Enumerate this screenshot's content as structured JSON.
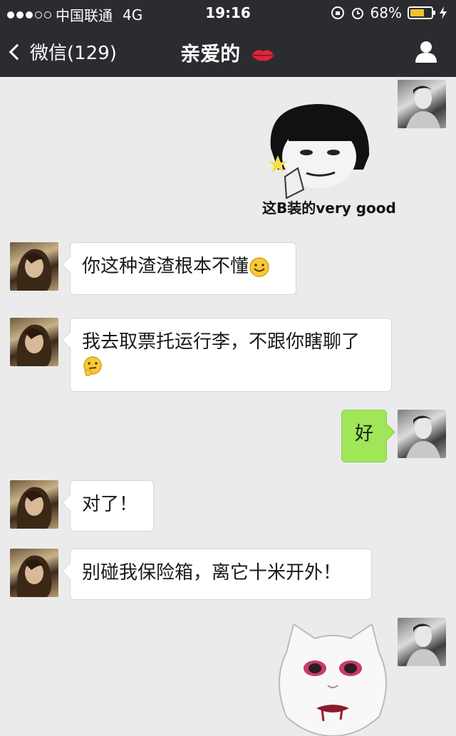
{
  "status_bar": {
    "carrier": "中国联通",
    "network": "4G",
    "time": "19:16",
    "battery_percent": "68%",
    "battery_level": 0.68,
    "battery_color": "#f2c12e"
  },
  "nav": {
    "back_label": "微信(129)",
    "title": "亲爱的",
    "title_icon": "lips-icon",
    "profile_icon": "person-icon"
  },
  "messages": [
    {
      "side": "right",
      "type": "sticker",
      "caption": "这B装的very good"
    },
    {
      "side": "left",
      "type": "text",
      "text": "你这种渣渣根本不懂",
      "emoji": "smile-icon"
    },
    {
      "side": "left",
      "type": "text",
      "line1": "我去取票托运行李，不跟你瞎聊了",
      "emoji": "thinking-icon"
    },
    {
      "side": "right",
      "type": "text",
      "text": "好"
    },
    {
      "side": "left",
      "type": "text",
      "text": "对了！"
    },
    {
      "side": "left",
      "type": "text",
      "text": "别碰我保险箱，离它十米开外！"
    },
    {
      "side": "right",
      "type": "sticker",
      "caption": ""
    }
  ],
  "colors": {
    "header_bg": "#2b2c30",
    "chat_bg": "#ebebeb",
    "sent_bubble": "#9fe658",
    "received_bubble": "#ffffff"
  }
}
